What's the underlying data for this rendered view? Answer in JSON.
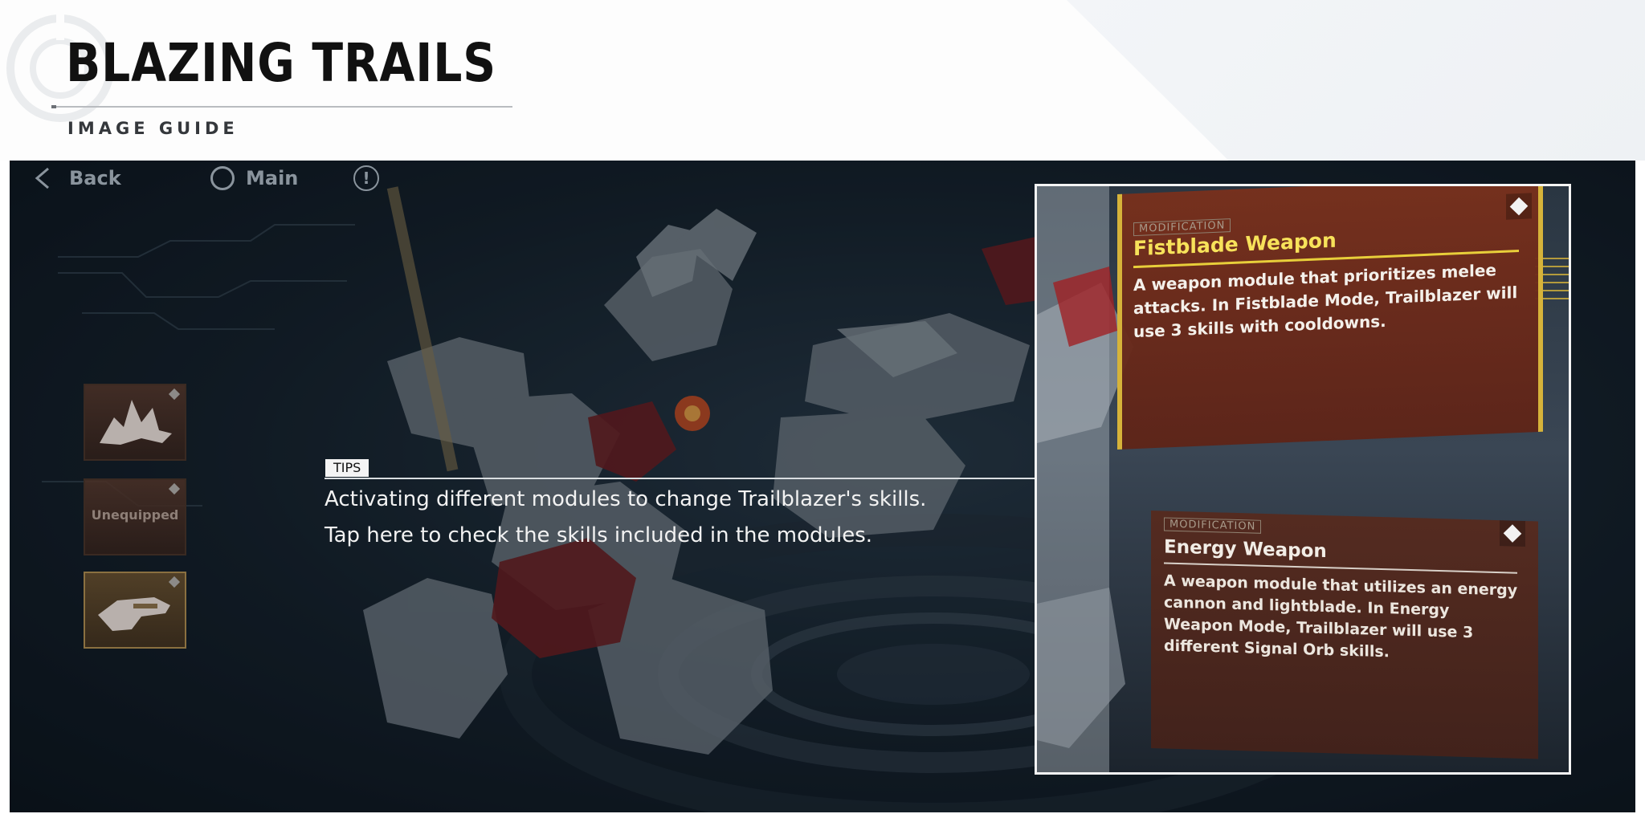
{
  "header": {
    "title": "BLAZING TRAILS",
    "subtitle": "IMAGE GUIDE"
  },
  "nav": {
    "back_label": "Back",
    "main_label": "Main",
    "info_glyph": "!"
  },
  "slots": [
    {
      "label": "",
      "icon": "fistblade-module-icon",
      "active": false
    },
    {
      "label": "Unequipped",
      "icon": "",
      "active": false
    },
    {
      "label": "",
      "icon": "energy-weapon-module-icon",
      "active": true
    }
  ],
  "tips": {
    "tag": "TIPS",
    "line1": "Activating different modules to change Trailblazer's skills.",
    "line2": "Tap here to check the skills included in the modules."
  },
  "cards": {
    "fistblade": {
      "tag": "MODIFICATION",
      "title": "Fistblade Weapon",
      "desc": "A weapon module that prioritizes melee attacks. In Fistblade Mode, Trailblazer will use 3 skills with cooldowns."
    },
    "energy": {
      "tag": "MODIFICATION",
      "title": "Energy Weapon",
      "desc": "A weapon module that utilizes an energy cannon and lightblade. In Energy Weapon Mode, Trailblazer will use 3 different Signal Orb skills."
    }
  },
  "colors": {
    "accent_gold": "#e8cf3a",
    "card_red": "#782e1c",
    "frame_border": "#f4f4f4"
  }
}
